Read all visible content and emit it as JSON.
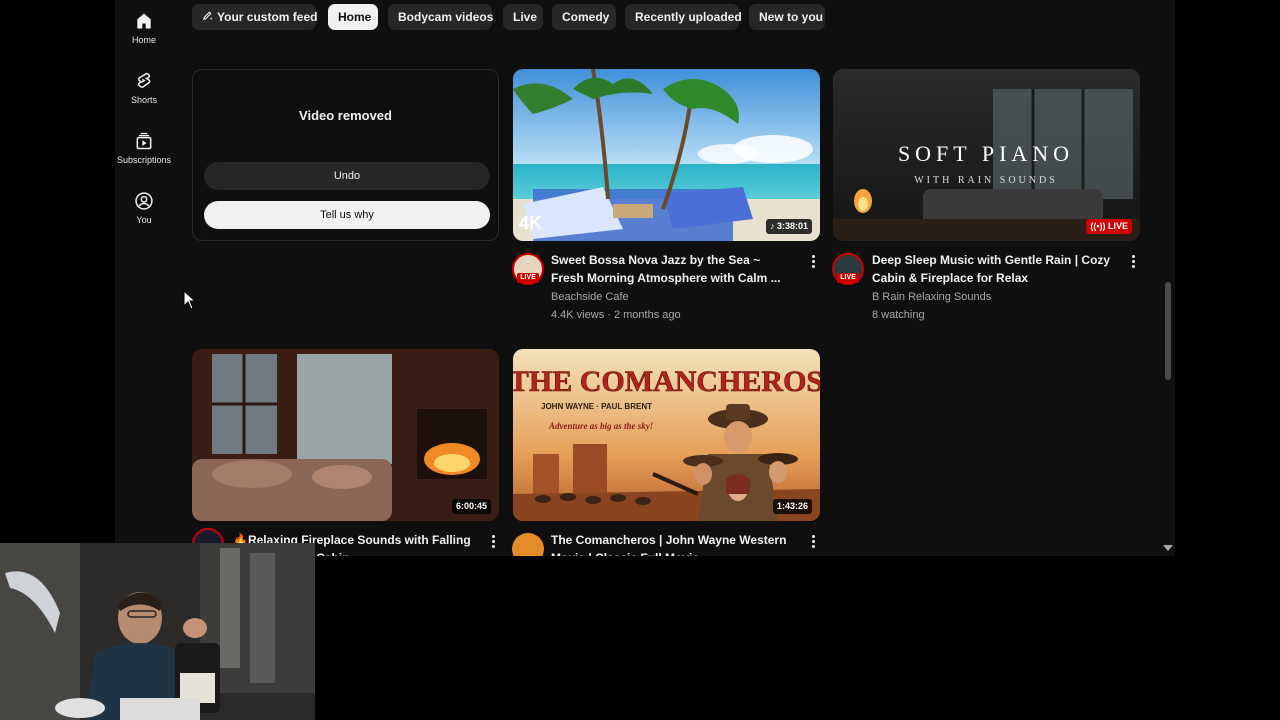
{
  "sidebar": {
    "items": [
      {
        "label": "Home",
        "icon": "home-icon"
      },
      {
        "label": "Shorts",
        "icon": "shorts-icon"
      },
      {
        "label": "Subscriptions",
        "icon": "subscriptions-icon"
      },
      {
        "label": "You",
        "icon": "you-icon"
      }
    ]
  },
  "chips": [
    {
      "label": "Your custom feed",
      "icon": "pencil-sparkle-icon"
    },
    {
      "label": "Home",
      "selected": true
    },
    {
      "label": "Bodycam videos"
    },
    {
      "label": "Live"
    },
    {
      "label": "Comedy"
    },
    {
      "label": "Recently uploaded"
    },
    {
      "label": "New to you"
    }
  ],
  "removed": {
    "title": "Video removed",
    "undo_label": "Undo",
    "tell_label": "Tell us why"
  },
  "videos": [
    {
      "title": "Sweet Bossa Nova Jazz by the Sea ~ Fresh Morning Atmosphere with Calm ...",
      "channel": "Beachside Cafe",
      "stats": "4.4K views · 2 months ago",
      "duration": "3:38:01",
      "thumb_text": "4K",
      "avatar_live_label": "LIVE"
    },
    {
      "title": "Deep Sleep Music with Gentle Rain | Cozy Cabin & Fireplace for Relax",
      "channel": "B Rain Relaxing Sounds",
      "stats": "8 watching",
      "badge": "LIVE",
      "thumb_text": "SOFT PIANO",
      "thumb_subtext": "WITH RAIN SOUNDS",
      "avatar_live_label": "LIVE"
    },
    {
      "title": "Relaxing Fireplace Sounds with Falling Snow - Winter Cabin ...",
      "duration": "6:00:45"
    },
    {
      "title": "The Comancheros | John Wayne Western Movie | Classic Full Movie",
      "duration": "1:43:26",
      "thumb_text": "THE COMANCHEROS",
      "thumb_subtext": "JOHN WAYNE · PAUL BRENT",
      "thumb_tagline": "Adventure as big as the sky!"
    }
  ],
  "colors": {
    "background": "#0f0f0f",
    "live_red": "#cc0000",
    "chip_bg": "#272727",
    "chip_active_bg": "#f1f1f1"
  }
}
